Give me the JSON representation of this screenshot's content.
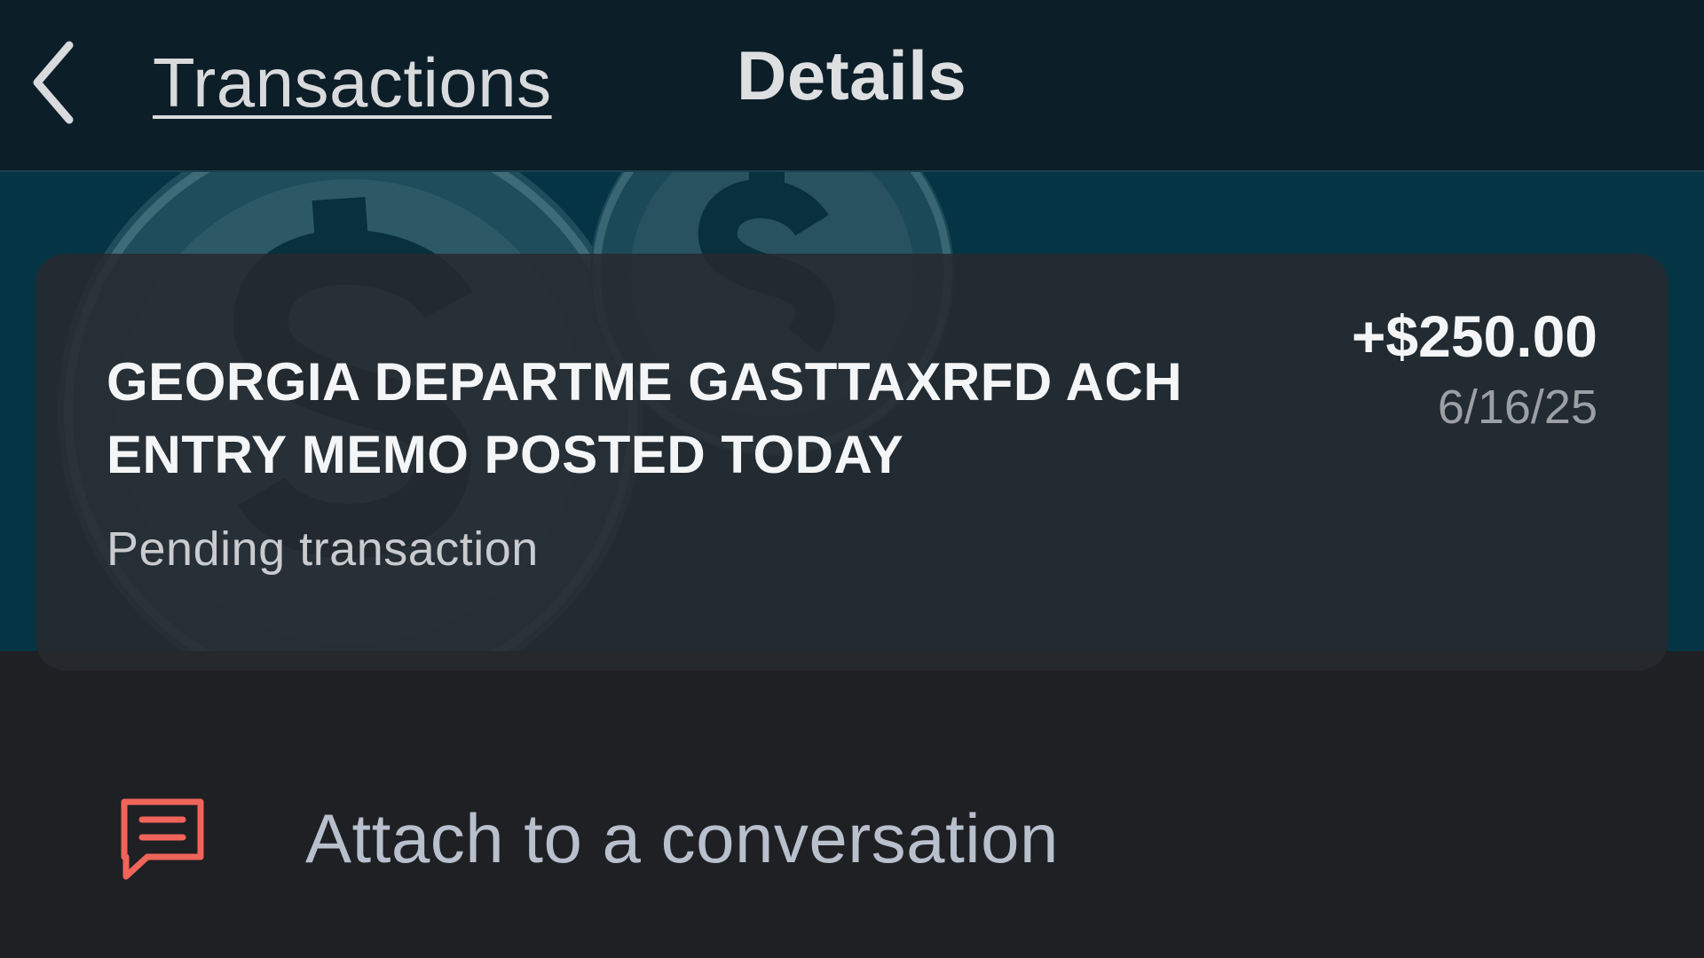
{
  "header": {
    "back_label": "Transactions",
    "title": "Details"
  },
  "transaction": {
    "merchant": "GEORGIA DEPARTME GASTTAXRFD ACH ENTRY MEMO POSTED TODAY",
    "amount": "+$250.00",
    "date": "6/16/25",
    "status": "Pending transaction"
  },
  "actions": {
    "attach_label": "Attach to a conversation"
  },
  "icons": {
    "back": "chevron-left-icon",
    "attach": "chat-message-icon",
    "hero": "dollar-coins-icon"
  },
  "colors": {
    "header_bg": "#0c1e28",
    "hero_bg": "#053444",
    "page_bg": "#1f2023",
    "card_bg": "#262a2e",
    "accent_icon": "#f0645a"
  }
}
